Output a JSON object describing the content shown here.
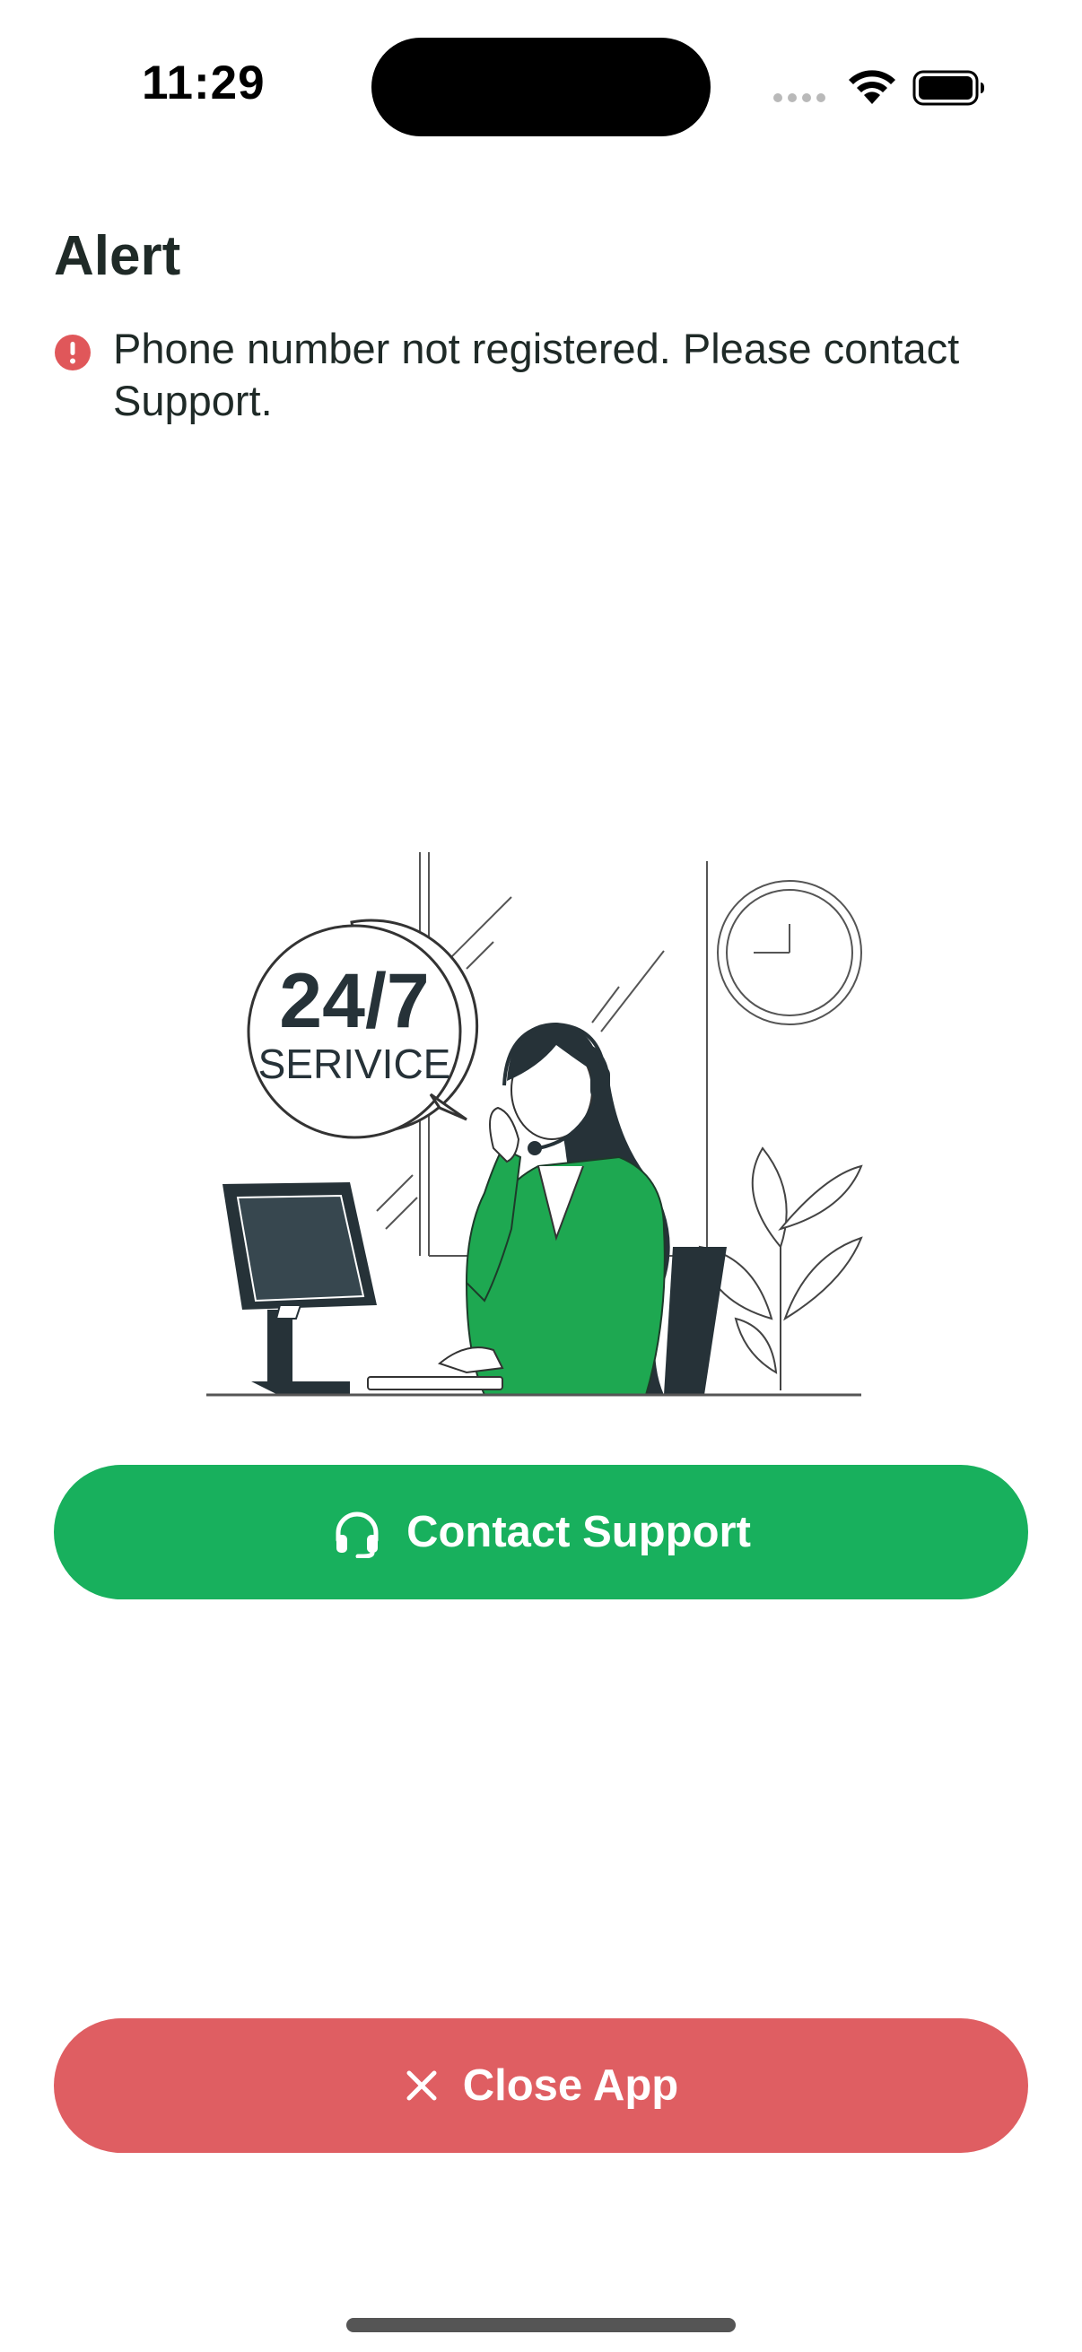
{
  "status_bar": {
    "time": "11:29"
  },
  "alert": {
    "title": "Alert",
    "message": "Phone number not registered. Please contact Support.",
    "icon": "exclamation-circle-icon",
    "icon_color": "#e0575a"
  },
  "illustration": {
    "bubble_line1": "24/7",
    "bubble_line2": "SERIVICE"
  },
  "buttons": {
    "contact_support": {
      "label": "Contact Support",
      "icon": "headset-icon",
      "color": "#18b05d"
    },
    "close_app": {
      "label": "Close App",
      "icon": "close-icon",
      "color": "#df5e62"
    }
  }
}
